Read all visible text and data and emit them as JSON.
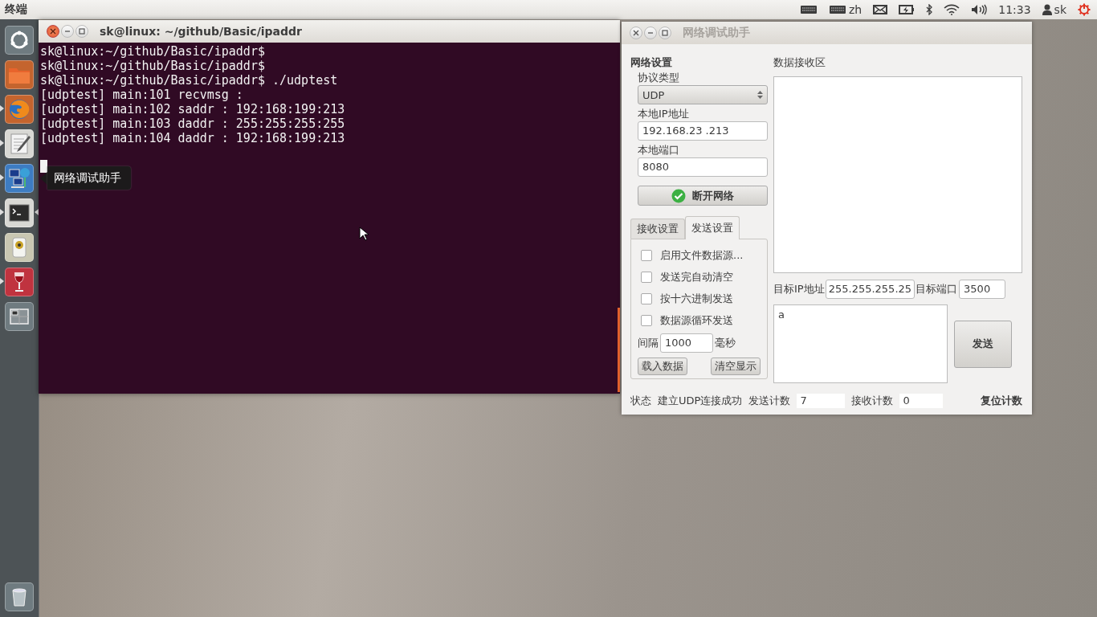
{
  "top_panel": {
    "app_name": "终端",
    "language": "zh",
    "clock": "11:33",
    "user": "sk"
  },
  "launcher": {
    "items": [
      {
        "kind": "dash",
        "running": false,
        "focused": false
      },
      {
        "kind": "files",
        "running": false,
        "focused": false
      },
      {
        "kind": "browser",
        "running": true,
        "focused": false
      },
      {
        "kind": "editor",
        "running": true,
        "focused": false
      },
      {
        "kind": "network",
        "running": true,
        "focused": false
      },
      {
        "kind": "terminal",
        "running": true,
        "focused": true
      },
      {
        "kind": "speaker",
        "running": false,
        "focused": false
      },
      {
        "kind": "wine",
        "running": true,
        "focused": false
      },
      {
        "kind": "workspaces",
        "running": false,
        "focused": false
      },
      {
        "kind": "trash",
        "running": false,
        "focused": false
      }
    ]
  },
  "tooltip": "网络调试助手",
  "terminal": {
    "title": "sk@linux: ~/github/Basic/ipaddr",
    "lines": [
      "sk@linux:~/github/Basic/ipaddr$",
      "sk@linux:~/github/Basic/ipaddr$",
      "sk@linux:~/github/Basic/ipaddr$ ./udptest",
      "[udptest] main:101 recvmsg :",
      "[udptest] main:102 saddr : 192:168:199:213",
      "[udptest] main:103 daddr : 255:255:255:255",
      "[udptest] main:104 daddr : 192:168:199:213"
    ]
  },
  "app": {
    "title": "网络调试助手",
    "network_settings": {
      "heading": "网络设置",
      "protocol_label": "协议类型",
      "protocol": "UDP",
      "local_ip_label": "本地IP地址",
      "local_ip": "192.168.23 .213",
      "local_port_label": "本地端口",
      "local_port": "8080",
      "connect_button": "断开网络"
    },
    "tabs": [
      {
        "label": "接收设置",
        "selected": false
      },
      {
        "label": "发送设置",
        "selected": true
      }
    ],
    "send_options": [
      {
        "label": "启用文件数据源...",
        "checked": false
      },
      {
        "label": "发送完自动清空",
        "checked": false
      },
      {
        "label": "按十六进制发送",
        "checked": false
      },
      {
        "label": "数据源循环发送",
        "checked": false
      }
    ],
    "interval": {
      "label": "间隔",
      "value": "1000",
      "unit": "毫秒"
    },
    "panel_buttons": [
      "载入数据",
      "清空显示"
    ],
    "receive_label": "数据接收区",
    "target_ip_label": "目标IP地址",
    "target_ip": "255.255.255.25",
    "target_port_label": "目标端口",
    "target_port": "3500",
    "send_text": "a",
    "send_button": "发送",
    "status": {
      "label": "状态",
      "message": "建立UDP连接成功",
      "sent_label": "发送计数",
      "sent": "7",
      "received_label": "接收计数",
      "received": "0",
      "reset_button": "复位计数"
    }
  }
}
